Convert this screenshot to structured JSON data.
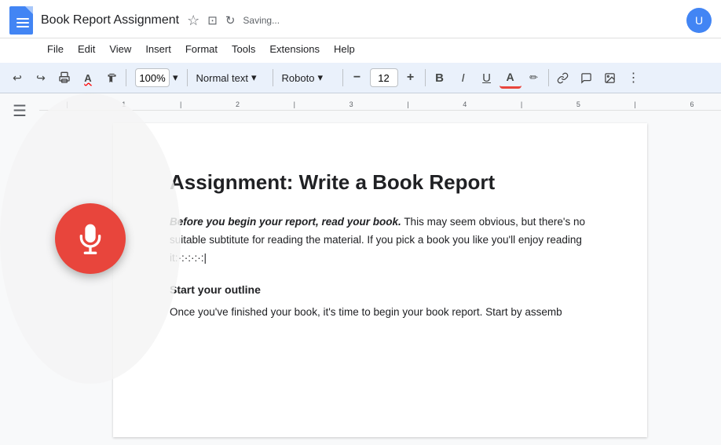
{
  "titleBar": {
    "docTitle": "Book Report Assignment",
    "savingStatus": "Saving...",
    "starLabel": "★",
    "driveLabel": "⊡",
    "syncLabel": "↻"
  },
  "menuBar": {
    "items": [
      "File",
      "Edit",
      "View",
      "Insert",
      "Format",
      "Tools",
      "Extensions",
      "Help"
    ]
  },
  "toolbar": {
    "undoLabel": "↩",
    "redoLabel": "↪",
    "printLabel": "🖨",
    "spellcheckLabel": "A",
    "paintFormatLabel": "🖌",
    "zoomValue": "100%",
    "zoomArrow": "▾",
    "styleValue": "Normal text",
    "styleArrow": "▾",
    "fontValue": "Roboto",
    "fontArrow": "▾",
    "fontSizeDecLabel": "−",
    "fontSizeValue": "12",
    "fontSizeIncLabel": "+",
    "boldLabel": "B",
    "italicLabel": "I",
    "underlineLabel": "U",
    "textColorLabel": "A",
    "highlightLabel": "✏",
    "linkLabel": "🔗",
    "commentLabel": "💬",
    "imageLabel": "🖼",
    "menuLabel": "≡"
  },
  "sidebar": {
    "outlineIcon": "≡"
  },
  "document": {
    "title": "Assignment: Write a Book Report",
    "paragraph1BoldItalic": "Before you begin your report, read your book.",
    "paragraph1Rest": " This may seem obvious, but there's no suitable subtitute for reading the material. If you pick a book you like you'll enjoy reading it:·:·:·:·:|",
    "subheading1": "Start your outline",
    "paragraph2": "Once you've finished your book, it's time to begin your book report. Start by assemb"
  },
  "colors": {
    "accent": "#4285f4",
    "micBg": "#e8453c",
    "toolbarBg": "#eaf1fb",
    "pageBg": "#f8f9fa"
  }
}
